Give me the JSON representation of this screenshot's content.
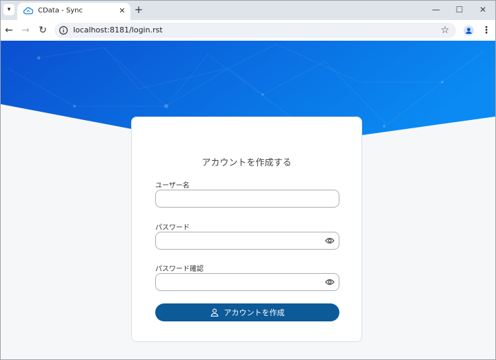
{
  "browser": {
    "tab_title": "CData - Sync",
    "url": "localhost:8181/login.rst",
    "controls": {
      "minimize": "—",
      "maximize": "☐",
      "close": "✕"
    },
    "icons": {
      "tab_list": "chevron-down-icon",
      "close_tab": "close-icon",
      "new_tab": "plus-icon",
      "back": "arrow-left-icon",
      "forward": "arrow-right-icon",
      "reload": "reload-icon",
      "bookmark": "star-icon",
      "profile": "person-icon",
      "menu": "kebab-icon"
    }
  },
  "form": {
    "title": "アカウントを作成する",
    "username_label": "ユーザー名",
    "username_value": "",
    "password_label": "パスワード",
    "password_value": "",
    "confirm_label": "パスワード確認",
    "confirm_value": "",
    "submit_label": "アカウントを作成"
  },
  "colors": {
    "hero_start": "#0b4fd0",
    "hero_end": "#0a8af2",
    "button": "#0d5a98",
    "page_bg": "#f6f7f9"
  }
}
